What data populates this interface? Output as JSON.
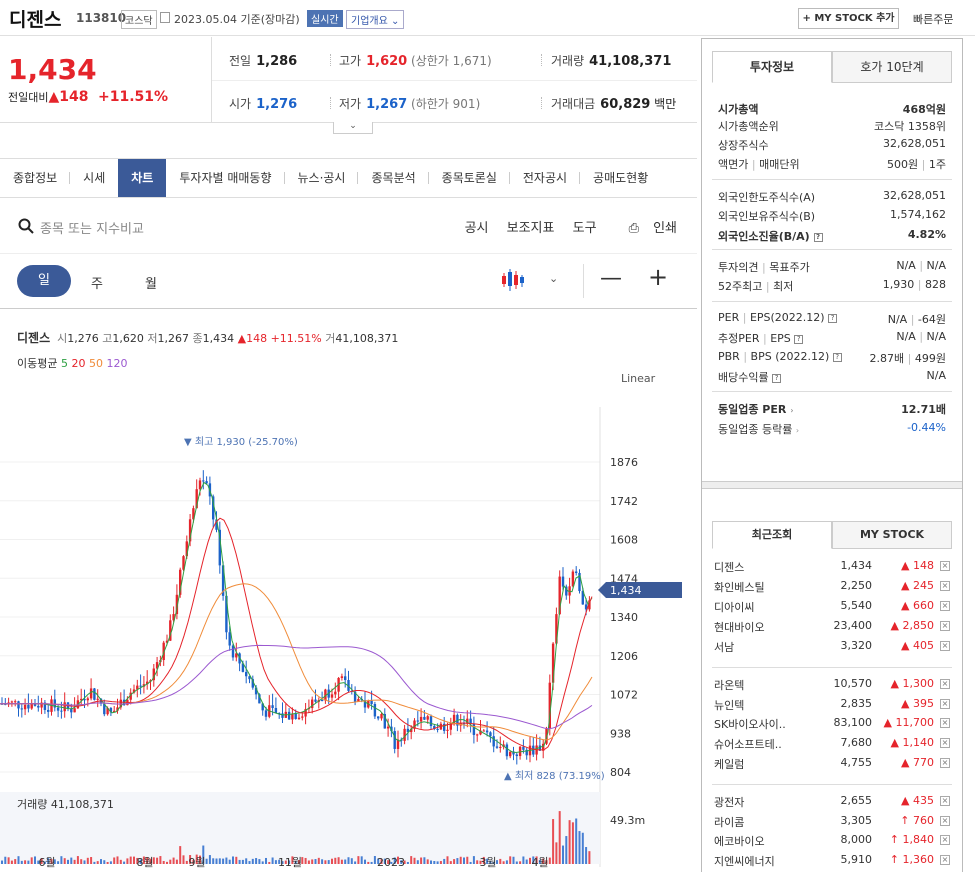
{
  "header": {
    "name": "디젠스",
    "code": "113810",
    "market": "코스닥",
    "date": "2023.05.04 기준(장마감)",
    "realtime": "실시간",
    "corp": "기업개요",
    "corp_arrow": "⌄",
    "mystock": "+ MY STOCK 추가",
    "quick": "빠른주문"
  },
  "price": {
    "current": "1,434",
    "vs_label": "전일대비",
    "arrow": "▲",
    "change": "148",
    "rate": "+11.51%",
    "prev_label": "전일",
    "prev": "1,286",
    "high_label": "고가",
    "high": "1,620",
    "upper": "(상한가 1,671)",
    "vol_label": "거래량",
    "vol": "41,108,371",
    "open_label": "시가",
    "open": "1,276",
    "low_label": "저가",
    "low": "1,267",
    "lower": "(하한가 901)",
    "amt_label": "거래대금",
    "amt": "60,829",
    "amt_unit": "백만",
    "toggle": "⌄"
  },
  "tabs": [
    "종합정보",
    "시세",
    "차트",
    "투자자별 매매동향",
    "뉴스·공시",
    "종목분석",
    "종목토론실",
    "전자공시",
    "공매도현황"
  ],
  "search": {
    "placeholder": "종목 또는 지수비교",
    "tools": [
      "공시",
      "보조지표",
      "도구",
      "인쇄"
    ]
  },
  "period": {
    "day": "일",
    "week": "주",
    "month": "월",
    "chevron": "⌄",
    "minus": "—",
    "plus": "+"
  },
  "chart_info": {
    "name": "디젠스",
    "o_l": "시",
    "o": "1,276",
    "h_l": "고",
    "h": "1,620",
    "l_l": "저",
    "l": "1,267",
    "c_l": "종",
    "c": "1,434",
    "chg": "▲148 +11.51%",
    "v_l": "거",
    "v": "41,108,371",
    "ma_label": "이동평균",
    "ma": [
      "5",
      "20",
      "50",
      "120"
    ],
    "ma_colors": [
      "#2ea043",
      "#e5242b",
      "#f08c3a",
      "#9b59d0"
    ],
    "scale": "Linear"
  },
  "chart_data": {
    "type": "candlestick",
    "yticks": [
      1876,
      1742,
      1608,
      1474,
      1340,
      1206,
      1072,
      938,
      804
    ],
    "xticks": [
      "6월",
      "8월",
      "9월",
      "11월",
      "2023",
      "3월",
      "4월"
    ],
    "max_label": "▼ 최고 1,930 (-25.70%)",
    "min_label": "▲ 최저 828 (73.19%)",
    "last_label": "1,434",
    "volume_label": "거래량 41,108,371",
    "volume_max": "49.3m",
    "up_color": "#e5242b",
    "down_color": "#1b62c9"
  },
  "right": {
    "tabs": [
      "투자정보",
      "호가 10단계"
    ],
    "rows": [
      {
        "l": "시가총액",
        "v": "468억원"
      },
      {
        "l": "시가총액순위",
        "v": "코스닥 1358위"
      },
      {
        "l": "상장주식수",
        "v": "32,628,051"
      },
      {
        "l": "액면가",
        "l2": "매매단위",
        "v": "500원",
        "v2": "1주"
      },
      {
        "l": "외국인한도주식수(A)",
        "v": "32,628,051"
      },
      {
        "l": "외국인보유주식수(B)",
        "v": "1,574,162"
      },
      {
        "l": "외국인소진율(B/A)",
        "v": "4.82%"
      },
      {
        "l": "투자의견",
        "l2": "목표주가",
        "v": "N/A",
        "v2": "N/A"
      },
      {
        "l": "52주최고",
        "l2": "최저",
        "v": "1,930",
        "v2": "828"
      },
      {
        "l": "PER",
        "l2": "EPS(2022.12)",
        "v": "N/A",
        "v2": "-64원"
      },
      {
        "l": "추정PER",
        "l2": "EPS",
        "v": "N/A",
        "v2": "N/A"
      },
      {
        "l": "PBR",
        "l2": "BPS (2022.12)",
        "v": "2.87배",
        "v2": "499원"
      },
      {
        "l": "배당수익률",
        "v": "N/A"
      },
      {
        "l": "동일업종 PER",
        "v": "12.71배"
      },
      {
        "l": "동일업종 등락률",
        "v": "-0.44%"
      }
    ],
    "tabs2": [
      "최근조회",
      "MY STOCK"
    ],
    "recent": [
      {
        "n": "디젠스",
        "p": "1,434",
        "c": "▲ 148"
      },
      {
        "n": "화인베스틸",
        "p": "2,250",
        "c": "▲ 245"
      },
      {
        "n": "디아이씨",
        "p": "5,540",
        "c": "▲ 660"
      },
      {
        "n": "현대바이오",
        "p": "23,400",
        "c": "▲ 2,850"
      },
      {
        "n": "서남",
        "p": "3,320",
        "c": "▲ 405"
      },
      {
        "n": "라온텍",
        "p": "10,570",
        "c": "▲ 1,300"
      },
      {
        "n": "뉴인텍",
        "p": "2,835",
        "c": "▲ 395"
      },
      {
        "n": "SK바이오사이..",
        "p": "83,100",
        "c": "▲ 11,700"
      },
      {
        "n": "슈어소프트테..",
        "p": "7,680",
        "c": "▲ 1,140"
      },
      {
        "n": "케일럼",
        "p": "4,755",
        "c": "▲ 770"
      },
      {
        "n": "광전자",
        "p": "2,655",
        "c": "▲ 435"
      },
      {
        "n": "라이콤",
        "p": "3,305",
        "c": "↑ 760"
      },
      {
        "n": "에코바이오",
        "p": "8,000",
        "c": "↑ 1,840"
      },
      {
        "n": "지엔씨에너지",
        "p": "5,910",
        "c": "↑ 1,360"
      }
    ],
    "close": "×"
  }
}
